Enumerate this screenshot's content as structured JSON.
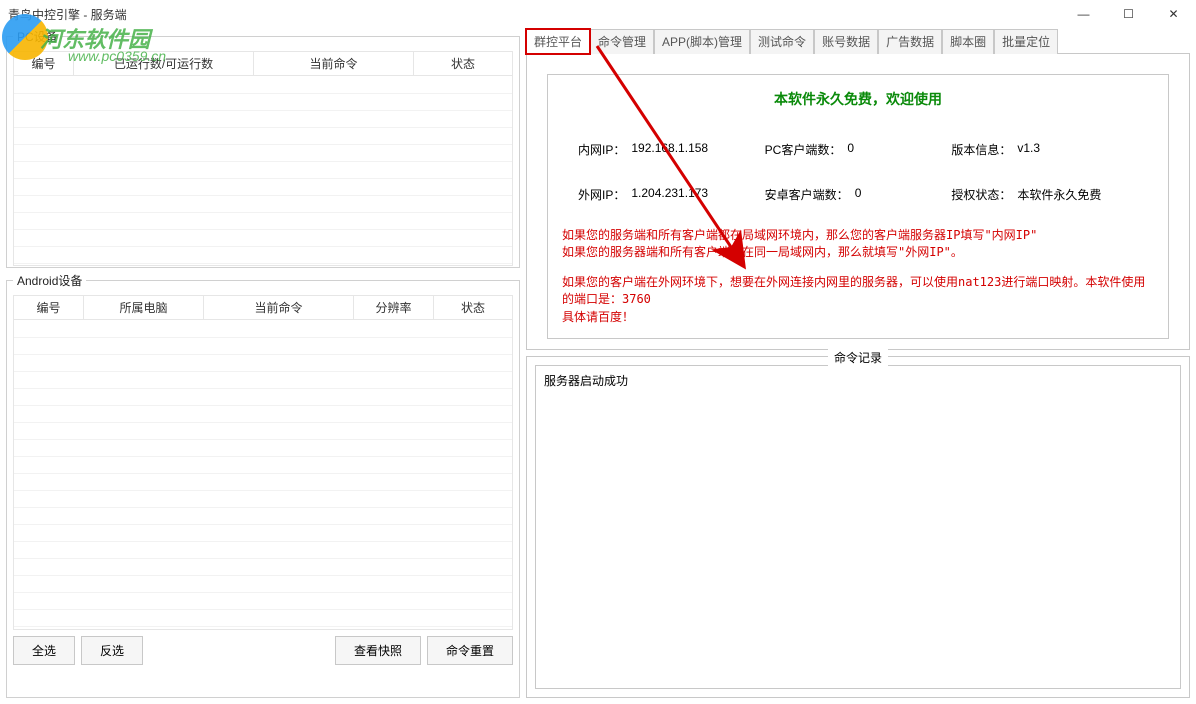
{
  "window": {
    "title": "青鸟中控引擎 - 服务端"
  },
  "watermark": {
    "text": "河东软件园",
    "url": "www.pc0359.cn"
  },
  "left": {
    "pc": {
      "title": "PC设备",
      "cols": [
        "编号",
        "已运行数/可运行数",
        "当前命令",
        "状态"
      ]
    },
    "android": {
      "title": "Android设备",
      "cols": [
        "编号",
        "所属电脑",
        "当前命令",
        "分辨率",
        "状态"
      ]
    },
    "buttons": {
      "select_all": "全选",
      "invert": "反选",
      "snapshot": "查看快照",
      "reset_cmd": "命令重置"
    }
  },
  "tabs": [
    "群控平台",
    "命令管理",
    "APP(脚本)管理",
    "测试命令",
    "账号数据",
    "广告数据",
    "脚本圈",
    "批量定位"
  ],
  "platform": {
    "headline": "本软件永久免费，欢迎使用",
    "row1": {
      "c1_label": "内网IP：",
      "c1_value": "192.168.1.158",
      "c2_label": "PC客户端数：",
      "c2_value": "0",
      "c3_label": "版本信息：",
      "c3_value": "v1.3"
    },
    "row2": {
      "c1_label": "外网IP：",
      "c1_value": "1.204.231.173",
      "c2_label": "安卓客户端数：",
      "c2_value": "0",
      "c3_label": "授权状态：",
      "c3_value": "本软件永久免费"
    },
    "red1": "如果您的服务端和所有客户端都在局域网环境内，那么您的客户端服务器IP填写\"内网IP\"\n如果您的服务器端和所有客户端不在同一局域网内，那么就填写\"外网IP\"。",
    "red2": "如果您的客户端在外网环境下，想要在外网连接内网里的服务器，可以使用nat123进行端口映射。本软件使用的端口是：3760\n具体请百度！"
  },
  "log": {
    "title": "命令记录",
    "lines": [
      "服务器启动成功"
    ]
  }
}
